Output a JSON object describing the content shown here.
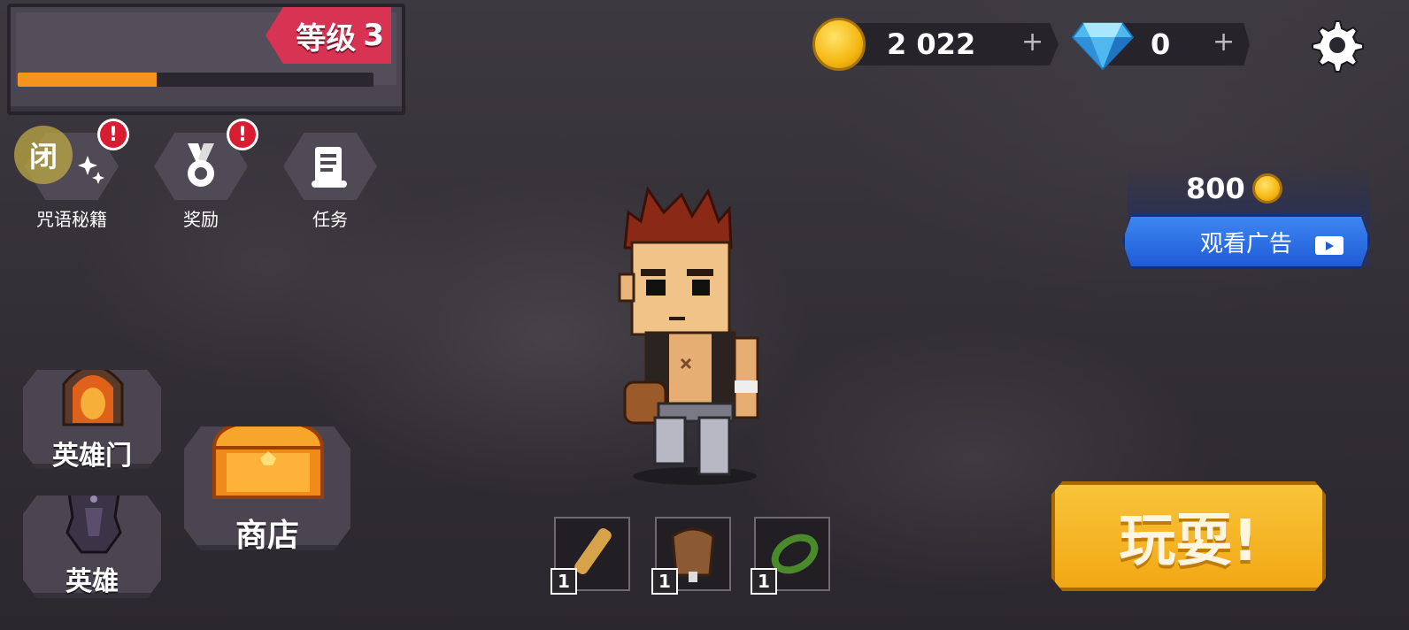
{
  "level": {
    "label": "等级",
    "value": "3",
    "xp_progress": 0.39
  },
  "currency": {
    "coins": {
      "value": "2 022",
      "plus": "+"
    },
    "gems": {
      "value": "0",
      "plus": "+"
    }
  },
  "menu": {
    "spellbook": {
      "label": "咒语秘籍",
      "glyph": "闭",
      "badge": "!"
    },
    "rewards": {
      "label": "奖励",
      "badge": "!"
    },
    "tasks": {
      "label": "任务"
    }
  },
  "ad": {
    "reward": "800",
    "button_label": "观看广告"
  },
  "buttons": {
    "hero_gate": "英雄门",
    "heroes": "英雄",
    "shop": "商店",
    "play": "玩耍!"
  },
  "inventory": [
    {
      "name": "scroll",
      "count": "1"
    },
    {
      "name": "leather-vest",
      "count": "1"
    },
    {
      "name": "jade-ring",
      "count": "1"
    }
  ],
  "colors": {
    "accent": "#d83352",
    "xp": "#f3941c",
    "play": "#f2a814",
    "ad": "#2a66e0"
  }
}
